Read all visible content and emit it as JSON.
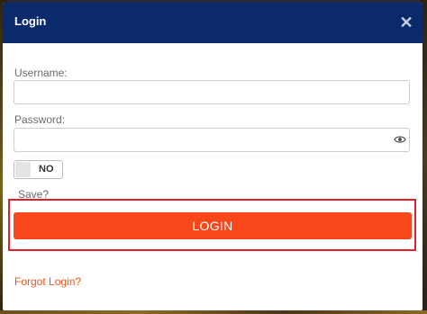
{
  "modal": {
    "title": "Login",
    "close_icon": "close-icon"
  },
  "form": {
    "username_label": "Username:",
    "username_value": "",
    "password_label": "Password:",
    "password_value": "",
    "password_toggle_icon": "eye-icon",
    "save_toggle_state": "NO",
    "save_label": "Save?",
    "login_button": "LOGIN",
    "forgot_link": "Forgot Login?"
  },
  "colors": {
    "header_bg": "#0b2a6b",
    "login_button_bg": "#f7471b",
    "highlight_border": "#e0202a",
    "link": "#e8561f"
  }
}
